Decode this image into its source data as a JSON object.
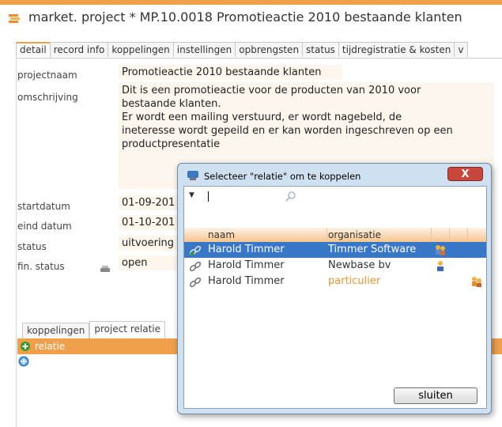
{
  "window": {
    "title": "market. project * MP.10.0018 Promotieactie 2010 bestaande klanten"
  },
  "tabs": [
    "detail",
    "record info",
    "koppelingen",
    "instellingen",
    "opbrengsten",
    "status",
    "tijdregistratie & kosten",
    "v"
  ],
  "form": {
    "projectnaam_label": "projectnaam",
    "projectnaam_value": "Promotieactie 2010 bestaande klanten",
    "omschrijving_label": "omschrijving",
    "omschrijving_lines": [
      "Dit is een promotieactie voor de producten van 2010 voor",
      "bestaande klanten.",
      "Er wordt een mailing verstuurd, er wordt nagebeld, de",
      "ineteresse wordt gepeild en er kan worden ingeschreven op een",
      "productpresentatie"
    ],
    "startdatum_label": "startdatum",
    "startdatum_value": "01-09-201",
    "einddatum_label": "eind datum",
    "einddatum_value": "01-10-201",
    "status_label": "status",
    "status_value": "uitvoering",
    "finstatus_label": "fin. status",
    "finstatus_value": "open"
  },
  "subtabs": [
    "koppelingen",
    "project relatie"
  ],
  "relatie_bar_label": "relatie",
  "dialog": {
    "title": "Selecteer \"relatie\" om te koppelen",
    "close_label": "X",
    "search_value": "",
    "columns": [
      "naam",
      "organisatie"
    ],
    "rows": [
      {
        "naam": "Harold Timmer",
        "organisatie": "Timmer Software",
        "selected": true
      },
      {
        "naam": "Harold Timmer",
        "organisatie": "Newbase bv",
        "selected": false
      },
      {
        "naam": "Harold Timmer",
        "organisatie": "particulier",
        "selected": false
      }
    ],
    "close_button": "sluiten"
  },
  "colors": {
    "accent": "#f0a04b",
    "selection": "#3876c8",
    "particulier": "#e8962e",
    "field_bg": "#fdf6ec"
  }
}
